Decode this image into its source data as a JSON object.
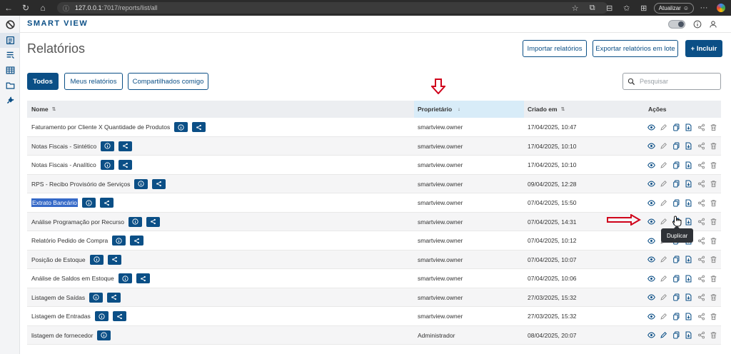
{
  "browser": {
    "url_host": "127.0.0.1",
    "url_path": ":7017/reports/list/all",
    "update_label": "Atualizar"
  },
  "app": {
    "brand": "SMART VIEW",
    "page_title": "Relatórios"
  },
  "toolbar": {
    "import_label": "Importar relatórios",
    "export_label": "Exportar relatórios em lote",
    "add_label": "+ Incluir"
  },
  "filters": {
    "all_label": "Todos",
    "mine_label": "Meus relatórios",
    "shared_label": "Compartilhados comigo"
  },
  "search": {
    "placeholder": "Pesquisar"
  },
  "table": {
    "columns": {
      "name": "Nome",
      "owner": "Proprietário",
      "created": "Criado em",
      "actions": "Ações"
    },
    "rows": [
      {
        "name": "Faturamento por Cliente X Quantidade de Produtos",
        "owner": "smartview.owner",
        "created": "17/04/2025, 10:47"
      },
      {
        "name": "Notas Fiscais - Sintético",
        "owner": "smartview.owner",
        "created": "17/04/2025, 10:10"
      },
      {
        "name": "Notas Fiscais - Analítico",
        "owner": "smartview.owner",
        "created": "17/04/2025, 10:10"
      },
      {
        "name": "RPS - Recibo Provisório de Serviços",
        "owner": "smartview.owner",
        "created": "09/04/2025, 12:28"
      },
      {
        "name": "Extrato Bancário",
        "owner": "smartview.owner",
        "created": "07/04/2025, 15:50"
      },
      {
        "name": "Análise Programação por Recurso",
        "owner": "smartview.owner",
        "created": "07/04/2025, 14:31"
      },
      {
        "name": "Relatório Pedido de Compra",
        "owner": "smartview.owner",
        "created": "07/04/2025, 10:12"
      },
      {
        "name": "Posição de Estoque",
        "owner": "smartview.owner",
        "created": "07/04/2025, 10:07"
      },
      {
        "name": "Análise de Saldos em Estoque",
        "owner": "smartview.owner",
        "created": "07/04/2025, 10:06"
      },
      {
        "name": "Listagem de Saídas",
        "owner": "smartview.owner",
        "created": "27/03/2025, 15:32"
      },
      {
        "name": "Listagem de Entradas",
        "owner": "smartview.owner",
        "created": "27/03/2025, 15:32"
      },
      {
        "name": "listagem de fornecedor",
        "owner": "Administrador",
        "created": "08/04/2025, 20:07"
      }
    ]
  },
  "tooltip": {
    "label": "Duplicar"
  },
  "colors": {
    "primary": "#0b4f86",
    "annotation": "#d0021b"
  },
  "icons": {
    "row_actions": [
      "eye-icon",
      "edit-icon",
      "duplicate-icon",
      "export-icon",
      "share-icon",
      "delete-icon"
    ]
  }
}
